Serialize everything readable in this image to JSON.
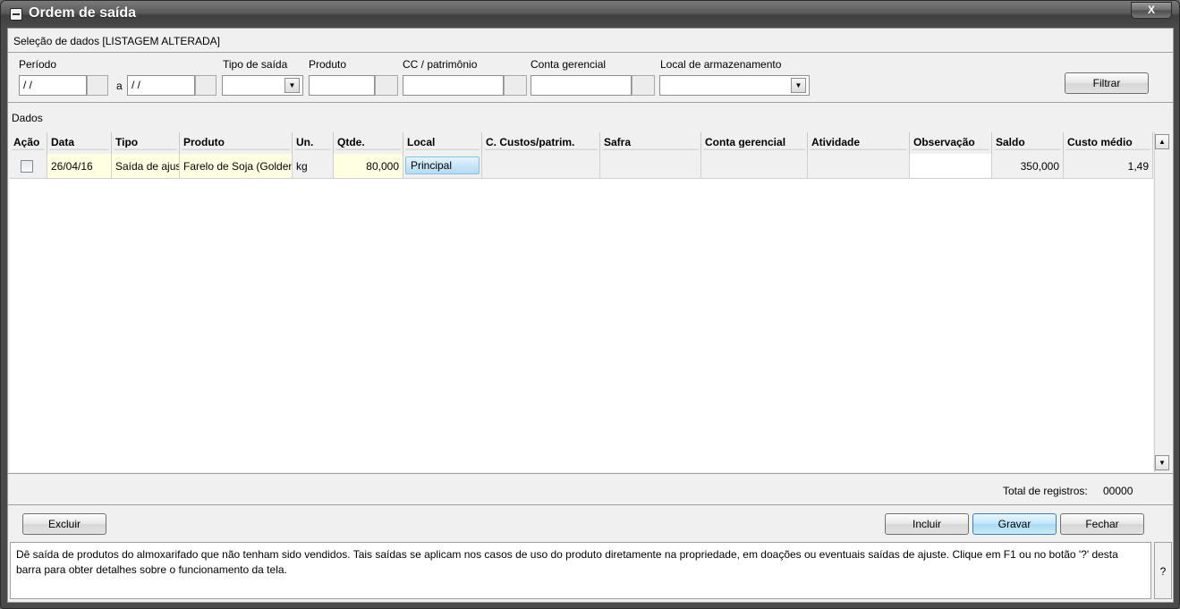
{
  "window": {
    "title": "Ordem de saída",
    "close_label": "X"
  },
  "filters": {
    "section_title": "Seleção de dados [LISTAGEM ALTERADA]",
    "periodo_label": "Período",
    "periodo_from": "/ /",
    "periodo_sep": "a",
    "periodo_to": "/ /",
    "tipo_saida_label": "Tipo de saída",
    "tipo_saida_value": "",
    "produto_label": "Produto",
    "produto_value": "",
    "cc_label": "CC / patrimônio",
    "cc_value": "",
    "conta_label": "Conta gerencial",
    "conta_value": "",
    "local_label": "Local de armazenamento",
    "local_value": "",
    "filter_button": "Filtrar"
  },
  "grid": {
    "section_title": "Dados",
    "columns": [
      "Ação",
      "Data",
      "Tipo",
      "Produto",
      "Un.",
      "Qtde.",
      "Local",
      "C. Custos/patrim.",
      "Safra",
      "Conta gerencial",
      "Atividade",
      "Observação",
      "Saldo",
      "Custo médio"
    ],
    "rows": [
      {
        "acao_checked": false,
        "data": "26/04/16",
        "tipo": "Saída de ajuste",
        "produto": "Farelo de Soja (Golden)",
        "un": "kg",
        "qtde": "80,000",
        "local": "Principal",
        "cc": "",
        "safra": "",
        "conta": "",
        "atividade": "",
        "observacao": "",
        "saldo": "350,000",
        "custo_medio": "1,49"
      }
    ],
    "total_label": "Total de registros:",
    "total_value": "00000"
  },
  "actions": {
    "excluir": "Excluir",
    "incluir": "Incluir",
    "gravar": "Gravar",
    "fechar": "Fechar"
  },
  "help": {
    "text": "Dê saída de produtos do almoxarifado que não tenham sido vendidos. Tais saídas se aplicam nos casos de uso do produto diretamente na propriedade, em doações ou eventuais saídas de ajuste. Clique em F1 ou no botão '?' desta barra para obter detalhes sobre o funcionamento da tela.",
    "button": "?"
  }
}
